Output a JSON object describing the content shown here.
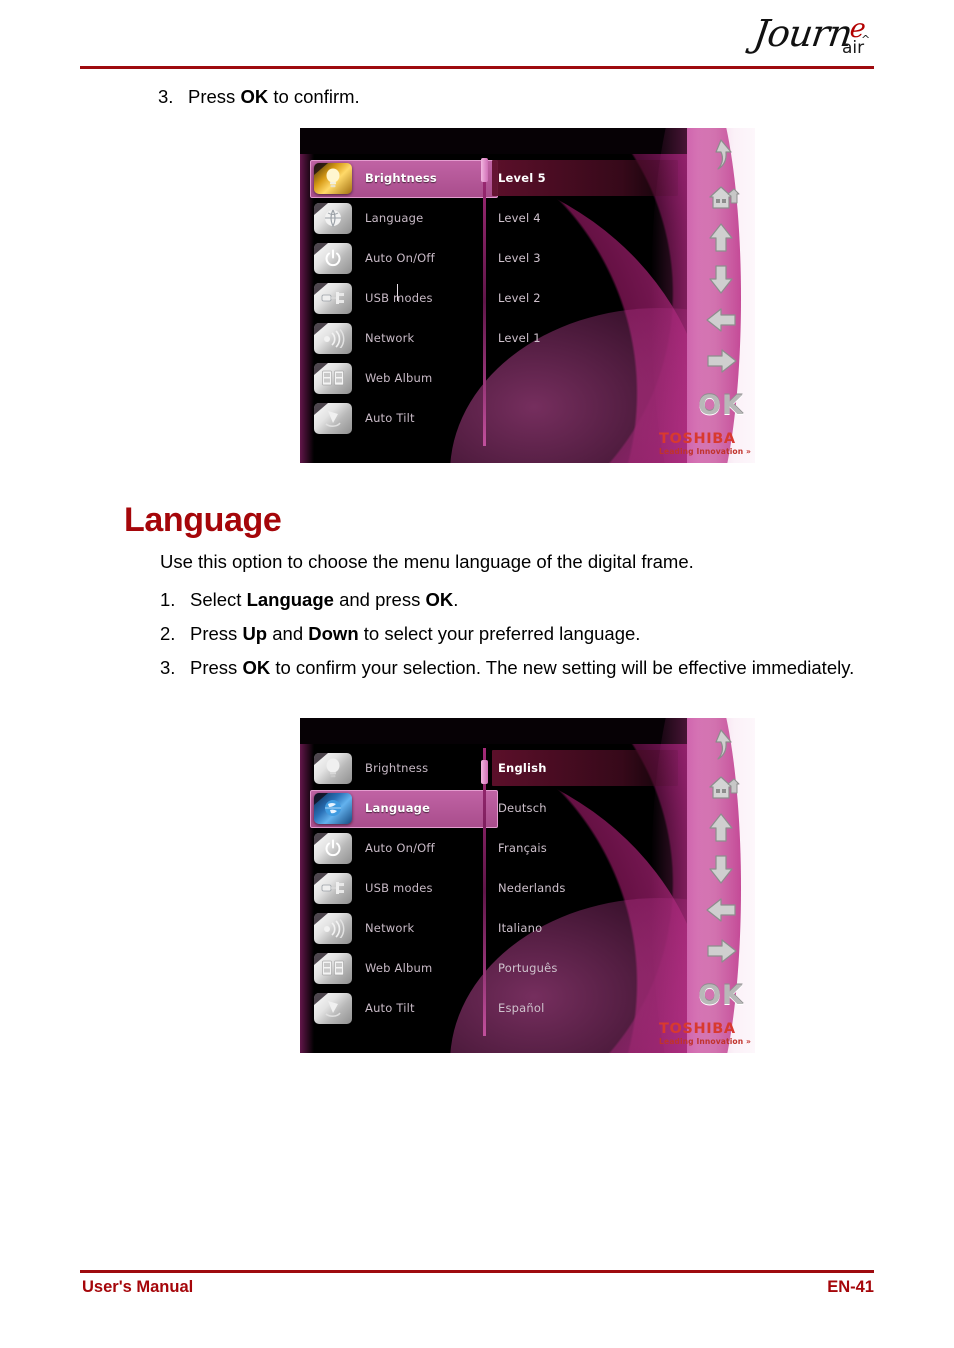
{
  "header": {
    "brand_main": "Journ",
    "brand_accent": "e",
    "brand_sub": "air"
  },
  "content": {
    "step_top": {
      "number": "3.",
      "text_before": "Press ",
      "bold": "OK",
      "text_after": " to confirm."
    },
    "section_title": "Language",
    "intro": "Use this option to choose the menu language of the digital frame.",
    "steps": [
      {
        "number": "1.",
        "parts": [
          "Select ",
          "Language",
          " and press ",
          "OK",
          "."
        ]
      },
      {
        "number": "2.",
        "parts": [
          "Press ",
          "Up",
          " and ",
          "Down",
          " to select your preferred language."
        ]
      },
      {
        "number": "3.",
        "parts": [
          "Press ",
          "OK",
          " to confirm your selection. The new setting will be effective immediately."
        ]
      }
    ]
  },
  "footer": {
    "left": "User's Manual",
    "right": "EN-41"
  },
  "device_menu": {
    "items": [
      {
        "label": "Brightness",
        "icon": "lightbulb-icon"
      },
      {
        "label": "Language",
        "icon": "globe-icon"
      },
      {
        "label": "Auto On/Off",
        "icon": "power-icon"
      },
      {
        "label": "USB modes",
        "icon": "usb-icon"
      },
      {
        "label": "Network",
        "icon": "network-icon"
      },
      {
        "label": "Web Album",
        "icon": "web-album-icon"
      },
      {
        "label": "Auto Tilt",
        "icon": "auto-tilt-icon"
      }
    ],
    "nav_icons": [
      "back-arrow-icon",
      "home-icon",
      "up-arrow-icon",
      "down-arrow-icon",
      "left-arrow-icon",
      "right-arrow-icon"
    ],
    "ok_label": "OK",
    "toshiba_name": "TOSHIBA",
    "toshiba_tagline": "Leading Innovation »"
  },
  "screenshot_brightness": {
    "selected_menu": "Brightness",
    "values": [
      "Level 5",
      "Level 4",
      "Level 3",
      "Level 2",
      "Level 1"
    ],
    "selected_value": "Level 5"
  },
  "screenshot_language": {
    "selected_menu": "Language",
    "values": [
      "English",
      "Deutsch",
      "Français",
      "Nederlands",
      "Italiano",
      "Português",
      "Español"
    ],
    "selected_value": "English"
  },
  "colors": {
    "accent_red": "#a5060a",
    "rule_red": "#9e0b0f",
    "toshiba_red": "#d8392f",
    "highlight_pink": "#b2579a"
  }
}
